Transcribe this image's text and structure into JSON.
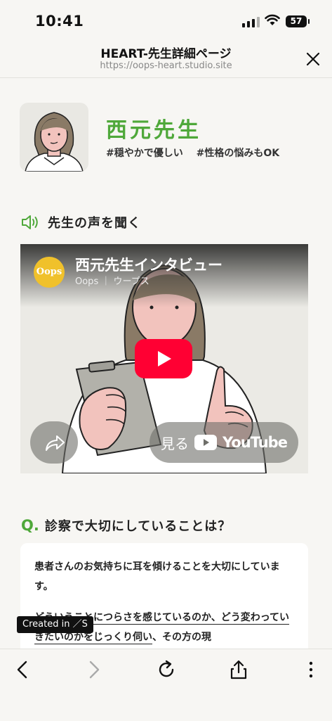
{
  "status_bar": {
    "time": "10:41",
    "battery": "57"
  },
  "browser": {
    "title": "HEART-先生詳細ページ",
    "url": "https://oops-heart.studio.site"
  },
  "teacher": {
    "name": "西元先生",
    "tags": "#穏やかで優しい #性格の悩みもOK"
  },
  "voice_section": {
    "title": "先生の声を聞く"
  },
  "video": {
    "channel_logo": "Oops",
    "title": "西元先生インタビュー",
    "subtitle": "Oops ｜ ウープス",
    "watch_label": "見る",
    "youtube_label": "YouTube"
  },
  "question": {
    "mark": "Q.",
    "text": "診察で大切にしていることは？"
  },
  "answer": {
    "p1": "患者さんのお気持ちに耳を傾けることを大切にしています。",
    "p2_underlined": "どういうことにつらさを感じているのか、どう変わっていきたいのかをじっくり伺い",
    "p2_rest": "、その方の現"
  },
  "badge": {
    "label": "Created in ／S"
  },
  "colors": {
    "accent": "#4fa83a",
    "youtube_red": "#ff0033",
    "logo_yellow": "#f0c12b"
  }
}
